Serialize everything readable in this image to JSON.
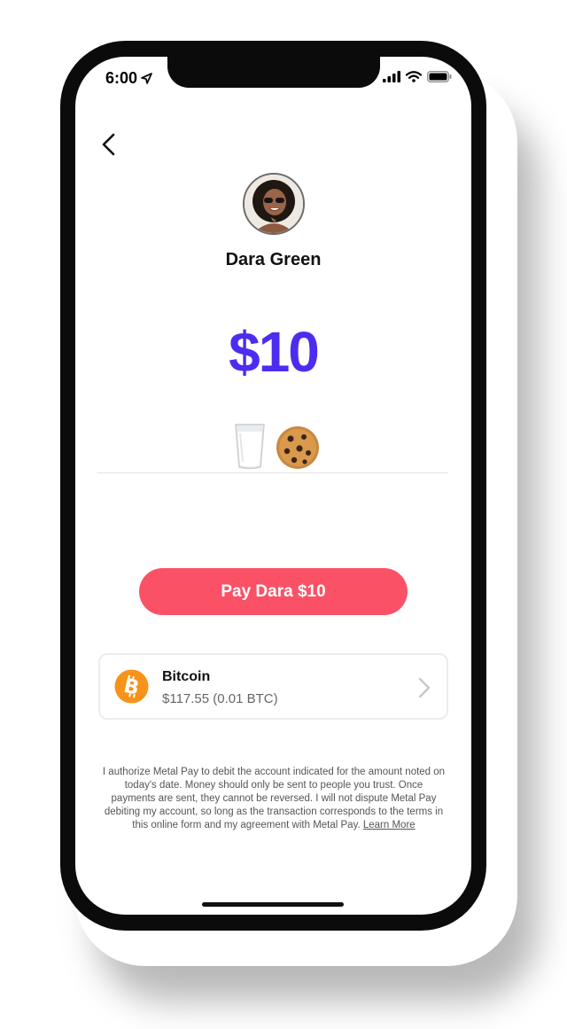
{
  "status_bar": {
    "time": "6:00"
  },
  "recipient": {
    "name": "Dara Green"
  },
  "payment": {
    "amount": "$10",
    "note": "🥛🍪",
    "pay_button_label": "Pay Dara $10"
  },
  "payment_method": {
    "name": "Bitcoin",
    "balance": "$117.55 (0.01 BTC)",
    "icon": "bitcoin-icon",
    "color": "#f7931a"
  },
  "legal": {
    "text": "I authorize Metal Pay to debit the account indicated for the amount noted on today's date. Money should only be sent to people you trust. Once payments are sent, they cannot be reversed. I will not dispute Metal Pay debiting my account, so long as the transaction corresponds to the terms in this online form and my agreement with Metal Pay.",
    "learn_more": "Learn More"
  },
  "colors": {
    "accent": "#4d2cf0",
    "pay_button": "#fb5166"
  }
}
